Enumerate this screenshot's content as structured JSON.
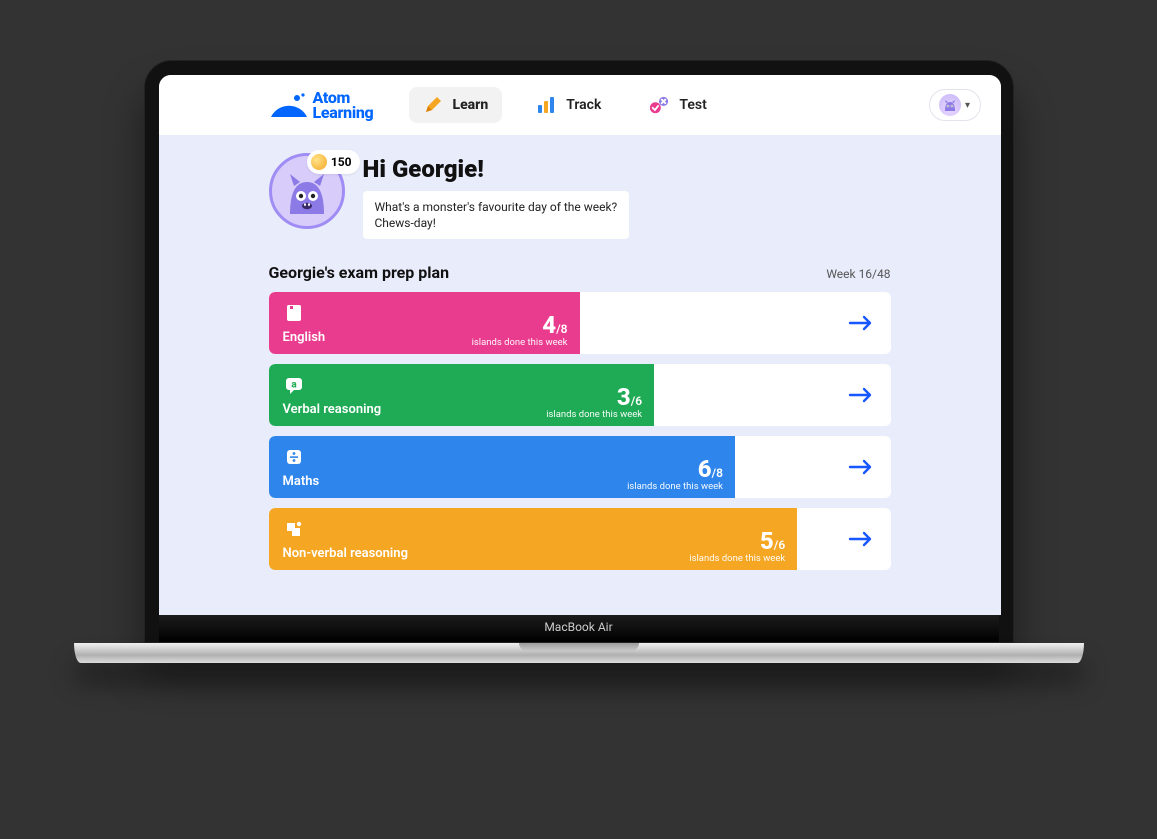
{
  "device": {
    "model": "MacBook Air"
  },
  "brand": {
    "line1": "Atom",
    "line2": "Learning"
  },
  "nav": {
    "learn": "Learn",
    "track": "Track",
    "test": "Test"
  },
  "coins": 150,
  "greeting": {
    "title": "Hi Georgie!",
    "joke_q": "What's a monster's favourite day of the week?",
    "joke_a": "Chews-day!"
  },
  "plan": {
    "title": "Georgie's exam prep plan",
    "week_label": "Week 16/48",
    "progress_label": "islands done this week"
  },
  "subjects": [
    {
      "name": "English",
      "done": 4,
      "total": 8,
      "color": "english",
      "fill_pct": 50
    },
    {
      "name": "Verbal reasoning",
      "done": 3,
      "total": 6,
      "color": "verbal",
      "fill_pct": 62
    },
    {
      "name": "Maths",
      "done": 6,
      "total": 8,
      "color": "maths",
      "fill_pct": 75
    },
    {
      "name": "Non-verbal reasoning",
      "done": 5,
      "total": 6,
      "color": "nvr",
      "fill_pct": 85
    }
  ]
}
